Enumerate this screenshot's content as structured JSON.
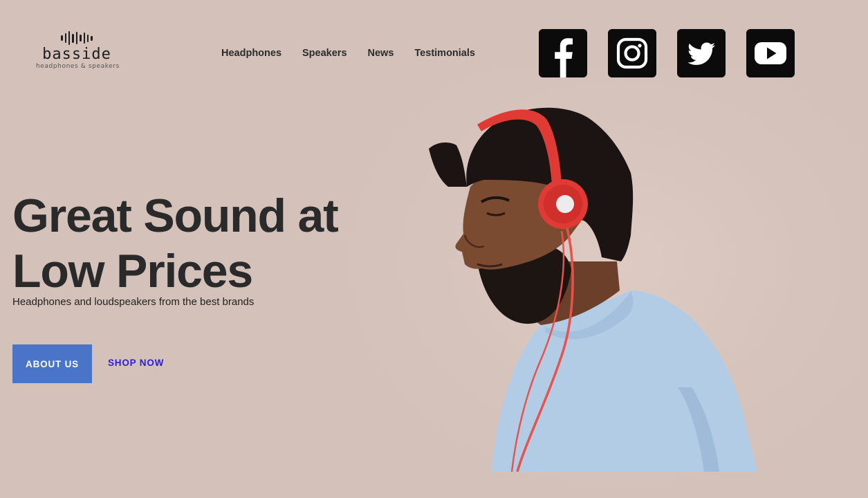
{
  "brand": {
    "name": "basside",
    "tagline": "headphones & speakers"
  },
  "nav": {
    "items": [
      "Headphones",
      "Speakers",
      "News",
      "Testimonials"
    ]
  },
  "social": {
    "icons": [
      "facebook-icon",
      "instagram-icon",
      "twitter-icon",
      "youtube-icon"
    ]
  },
  "hero": {
    "title_line1": "Great Sound at",
    "title_line2": "Low Prices",
    "subtitle": "Headphones and loudspeakers from the best brands",
    "primary_button": "ABOUT US",
    "secondary_link": "SHOP NOW"
  },
  "colors": {
    "background": "#d4c2ba",
    "primary_button": "#4a74c8",
    "link": "#2a1ed8",
    "text": "#2b2b2b",
    "headphones": "#e03a34",
    "sweater": "#b2cce6"
  }
}
